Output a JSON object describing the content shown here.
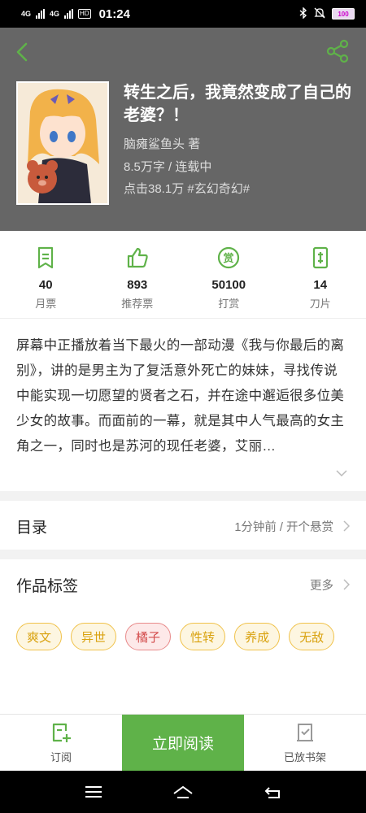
{
  "status_bar": {
    "net1": "4G",
    "net2": "4G",
    "hd": "HD",
    "time": "01:24",
    "battery": "100"
  },
  "book": {
    "title": "转生之后，我竟然变成了自己的老婆？！",
    "author": "脑瘫鲨鱼头  著",
    "words_status": "8.5万字 / 连载中",
    "clicks_genre": "点击38.1万  #玄幻奇幻#"
  },
  "stats": [
    {
      "icon": "monthly-ticket-icon",
      "value": "40",
      "label": "月票"
    },
    {
      "icon": "thumbs-up-icon",
      "value": "893",
      "label": "推荐票"
    },
    {
      "icon": "reward-icon",
      "value": "50100",
      "label": "打赏"
    },
    {
      "icon": "blade-icon",
      "value": "14",
      "label": "刀片"
    }
  ],
  "description": "屏幕中正播放着当下最火的一部动漫《我与你最后的离别》，讲的是男主为了复活意外死亡的妹妹，寻找传说中能实现一切愿望的贤者之石，并在途中邂逅很多位美少女的故事。而面前的一幕，就是其中人气最高的女主角之一，同时也是苏河的现任老婆，艾丽…",
  "catalog": {
    "label": "目录",
    "info": "1分钟前 / 开个悬赏"
  },
  "tags_section": {
    "label": "作品标签",
    "more": "更多"
  },
  "tags": [
    "爽文",
    "异世",
    "橘子",
    "性转",
    "养成",
    "无敌"
  ],
  "bottom": {
    "subscribe": "订阅",
    "read": "立即阅读",
    "shelf": "已放书架"
  },
  "colors": {
    "accent": "#5fb249",
    "header_bg": "#666666"
  }
}
